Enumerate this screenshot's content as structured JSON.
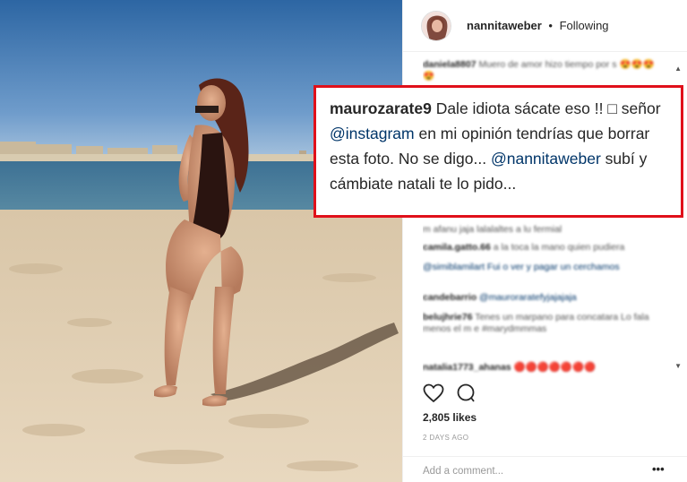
{
  "post": {
    "username": "nannitaweber",
    "separator": "•",
    "follow_status": "Following"
  },
  "comments": [
    {
      "user": "daniela8807",
      "text": "Muero de amor hizo tiempo por s 😍😍😍😍"
    },
    {
      "user": "",
      "text": "m afanu jaja lalalaltes a lu fermial"
    },
    {
      "user": "camila.gatto.66",
      "text": "a la toca la mano quien pudiera"
    },
    {
      "user": "",
      "text": "@simiblamilart Fui o ver y pagar un cerchamos"
    },
    {
      "user": "candebarrio",
      "text": "@mauroraratefyjajajaja"
    },
    {
      "user": "belujhrie76",
      "text": "Tenes un marpano para concatara Lo fala menos el m e #marydmmmas"
    },
    {
      "user": "natalia1773_ahanas",
      "text": "🔴🔴🔴🔴🔴🔴🔴"
    }
  ],
  "highlighted_comment": {
    "user": "maurozarate9",
    "text_1": "Dale idiota sácate eso !! ",
    "text_2": "señor ",
    "mention_1": "@instagram",
    "text_3": " en mi opinión tendrías que borrar esta foto. No se digo... ",
    "mention_2": "@nannitaweber",
    "text_4": " subí y cámbiate natali te lo pido..."
  },
  "likes": "2,805 likes",
  "date": "2 DAYS AGO",
  "add_comment_placeholder": "Add a comment...",
  "more_options": "•••",
  "icons": {
    "like": "heart-icon",
    "comment": "comment-icon",
    "scroll_up": "scroll-up-icon",
    "scroll_down": "scroll-down-icon"
  },
  "colors": {
    "highlight_border": "#e0101a",
    "mention": "#003569",
    "text": "#262626",
    "muted": "#999999"
  }
}
